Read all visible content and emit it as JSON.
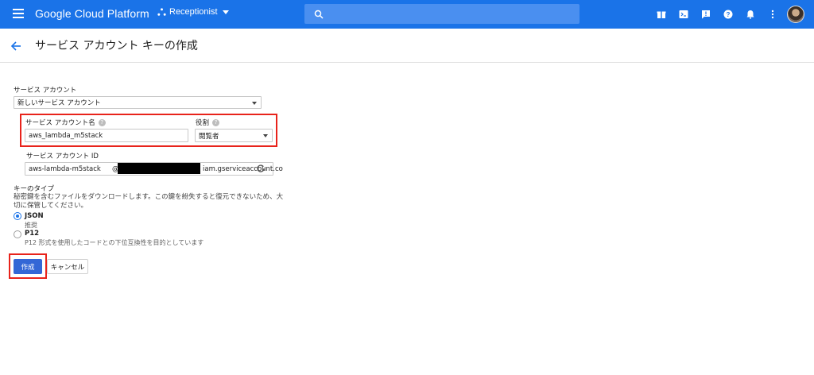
{
  "topbar": {
    "brand": "Google Cloud Platform",
    "project": "Receptionist",
    "search_placeholder": "",
    "icons": [
      "gift-icon",
      "terminal-icon",
      "feedback-icon",
      "help-icon",
      "notifications-icon",
      "more-vert-icon"
    ]
  },
  "header": {
    "title": "サービス アカウント キーの作成"
  },
  "form": {
    "service_account_label": "サービス アカウント",
    "service_account_value": "新しいサービス アカウント",
    "account_name_label": "サービス アカウント名",
    "account_name_value": "aws_lambda_m5stack",
    "role_label": "役割",
    "role_value": "閲覧者",
    "account_id_label": "サービス アカウント ID",
    "account_id_value": "aws-lambda-m5stack",
    "account_id_at": "@",
    "account_id_domain": "iam.gserviceaccount.co",
    "key_type_label": "キーのタイプ",
    "key_type_desc_1": "秘密鍵を含むファイルをダウンロードします。この鍵を紛失すると復元できないため、大",
    "key_type_desc_2": "切に保管してください。",
    "options": [
      {
        "label": "JSON",
        "sub": "推奨",
        "checked": true
      },
      {
        "label": "P12",
        "sub": "P12 形式を使用したコードとの下位互換性を目的としています",
        "checked": false
      }
    ]
  },
  "buttons": {
    "create": "作成",
    "cancel": "キャンセル"
  },
  "colors": {
    "topbar": "#1a73e8",
    "primary_button": "#3367d6",
    "highlight": "#e8231b"
  }
}
